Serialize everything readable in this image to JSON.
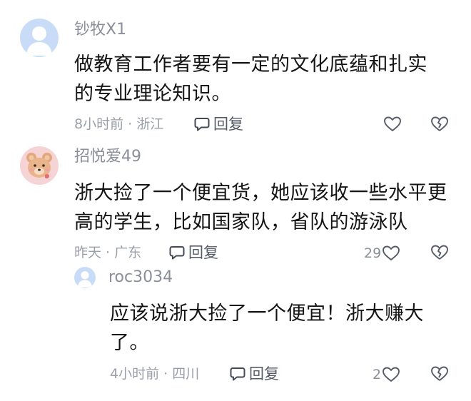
{
  "comments": [
    {
      "username": "钞牧X1",
      "content": "做教育工作者要有一定的文化底蕴和扎实的专业理论知识。",
      "meta": "8小时前 · 浙江",
      "reply_label": "回复",
      "like_count": ""
    },
    {
      "username": "招悦爱49",
      "content": "浙大捡了一个便宜货，她应该收一些水平更高的学生，比如国家队，省队的游泳队",
      "meta": "昨天 · 广东",
      "reply_label": "回复",
      "like_count": "29"
    },
    {
      "username": "roc3034",
      "content": "应该说浙大捡了一个便宜！浙大赚大了。",
      "meta": "4小时前 · 四川",
      "reply_label": "回复",
      "like_count": "2"
    }
  ],
  "icons": {
    "reply": "speech-bubble-icon",
    "like": "heart-icon",
    "dislike": "broken-heart-icon"
  },
  "colors": {
    "username": "#8a8f99",
    "content": "#141414",
    "meta": "#9aa0a8",
    "avatar_default": "#c9dcf7",
    "bear_avatar_bg": "#f6d3d4"
  }
}
